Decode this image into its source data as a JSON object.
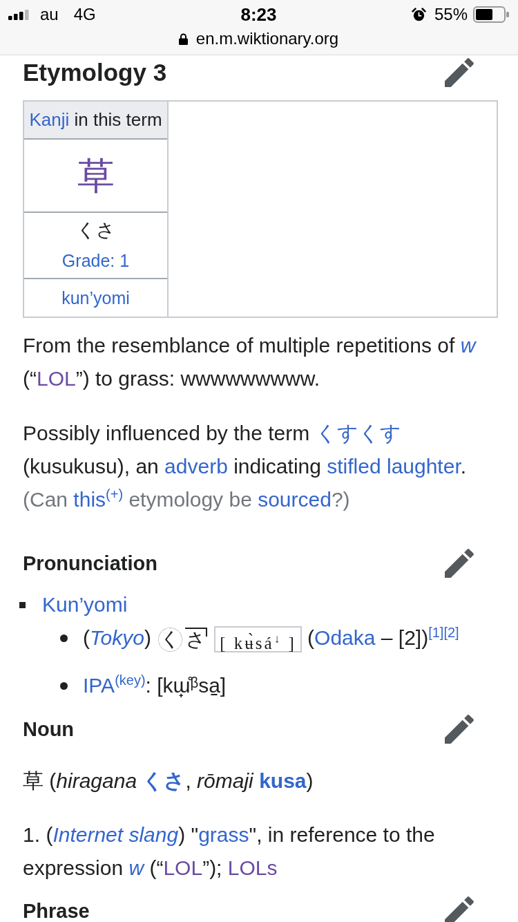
{
  "status_bar": {
    "carrier": "au",
    "network": "4G",
    "time": "8:23",
    "battery_percent": "55%"
  },
  "address_bar": {
    "url": "en.m.wiktionary.org"
  },
  "etymology": {
    "heading": {
      "text": "Etymology 3",
      "kind": "h3"
    },
    "kanji_table": {
      "header": [
        {
          "kind": "link",
          "t": "Kanji"
        },
        {
          "kind": "text",
          "t": " in this term"
        }
      ],
      "kanji": {
        "kind": "visited",
        "t": "草"
      },
      "reading": "くさ",
      "grade": {
        "kind": "link",
        "t": "Grade: 1"
      },
      "yomi": {
        "kind": "link",
        "t": "kun’yomi"
      }
    },
    "paragraphs": [
      {
        "kind": "body",
        "segments": [
          {
            "kind": "text",
            "t": "From the resemblance of multiple repetitions of "
          },
          {
            "kind": "link_em",
            "t": "w"
          },
          {
            "kind": "text",
            "t": " (“"
          },
          {
            "kind": "visited",
            "t": "LOL"
          },
          {
            "kind": "text",
            "t": "”) to grass: wwwwwwwww."
          }
        ]
      },
      {
        "kind": "body",
        "segments": [
          {
            "kind": "text",
            "t": "Possibly influenced by the term "
          },
          {
            "kind": "link",
            "t": "くすくす"
          },
          {
            "kind": "text",
            "t": " (kusukusu), an "
          },
          {
            "kind": "link",
            "t": "adverb"
          },
          {
            "kind": "text",
            "t": " indicating "
          },
          {
            "kind": "link",
            "t": "stifled laughter"
          },
          {
            "kind": "text",
            "t": "."
          }
        ]
      },
      {
        "kind": "note",
        "segments": [
          {
            "kind": "text",
            "t": "(Can "
          },
          {
            "kind": "link",
            "t": "this"
          },
          {
            "kind": "sup_link",
            "t": "(+)"
          },
          {
            "kind": "text",
            "t": " etymology be "
          },
          {
            "kind": "link",
            "t": "sourced"
          },
          {
            "kind": "text",
            "t": "?)"
          }
        ]
      }
    ]
  },
  "pronunciation": {
    "heading": {
      "text": "Pronunciation",
      "kind": "h4"
    },
    "items": [
      {
        "segments": [
          {
            "kind": "link",
            "t": "Kun’yomi"
          }
        ],
        "children": [
          {
            "segments": [
              {
                "kind": "text",
                "t": "("
              },
              {
                "kind": "link_em",
                "t": "Tokyo"
              },
              {
                "kind": "text",
                "t": ") "
              },
              {
                "kind": "mora",
                "t": "く",
                "devoiced": true,
                "high": false,
                "drop": false
              },
              {
                "kind": "mora",
                "t": "さ",
                "devoiced": false,
                "high": true,
                "drop": true
              },
              {
                "kind": "phonetic",
                "t": "[ kʉ̀sá$^{↓}$ ]"
              },
              {
                "kind": "text",
                "t": " ("
              },
              {
                "kind": "link",
                "t": "Odaka"
              },
              {
                "kind": "text",
                "t": " – [2])"
              },
              {
                "kind": "sup_link",
                "t": "[1]"
              },
              {
                "kind": "sup_link",
                "t": "[2]"
              }
            ]
          },
          {
            "segments": [
              {
                "kind": "link",
                "t": "IPA"
              },
              {
                "kind": "sup_link",
                "t": "(key)"
              },
              {
                "kind": "text",
                "t": ": [kɯ̟̊ᵝsa̠]"
              }
            ]
          }
        ]
      }
    ]
  },
  "noun": {
    "heading": {
      "text": "Noun",
      "kind": "h4"
    },
    "headword_line": [
      {
        "kind": "headword",
        "t": "草"
      },
      {
        "kind": "text",
        "t": " (*hiragana* "
      },
      {
        "kind": "link_strong",
        "t": "くさ"
      },
      {
        "kind": "text",
        "t": ", *rōmaji* "
      },
      {
        "kind": "link_strong",
        "t": "kusa"
      },
      {
        "kind": "text",
        "t": ")"
      }
    ],
    "definitions": [
      {
        "number": "1.",
        "segments": [
          {
            "kind": "text",
            "t": "("
          },
          {
            "kind": "link_em",
            "t": "Internet slang"
          },
          {
            "kind": "text",
            "t": ") \""
          },
          {
            "kind": "link",
            "t": "grass"
          },
          {
            "kind": "text",
            "t": "\", in reference to the expression "
          },
          {
            "kind": "link_em",
            "t": "w"
          },
          {
            "kind": "text",
            "t": " (“"
          },
          {
            "kind": "visited",
            "t": "LOL"
          },
          {
            "kind": "text",
            "t": "”); "
          },
          {
            "kind": "visited",
            "t": "LOLs"
          }
        ]
      }
    ]
  },
  "phrase": {
    "heading": {
      "text": "Phrase",
      "kind": "h4"
    }
  }
}
